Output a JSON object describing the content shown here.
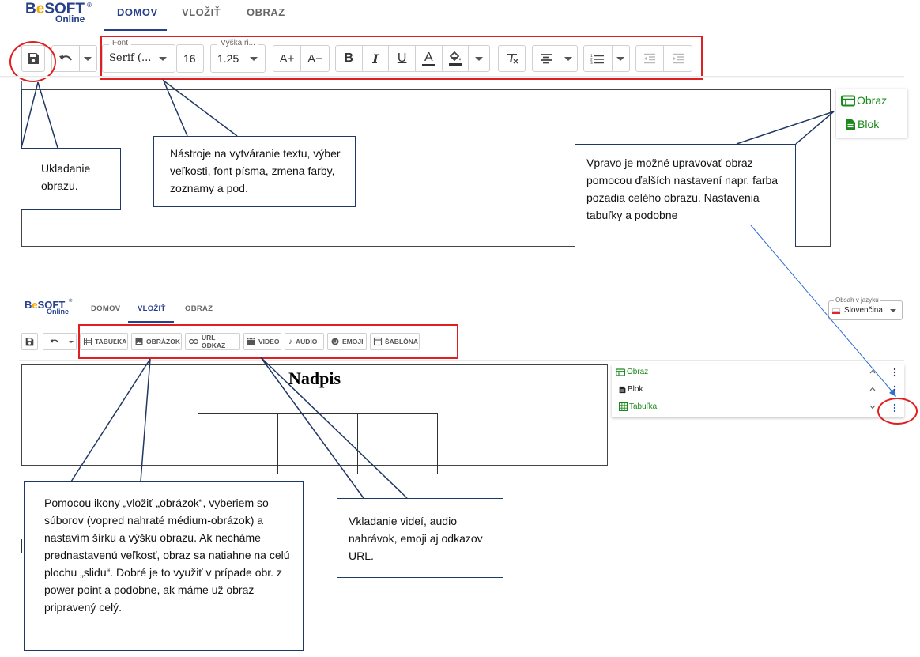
{
  "app": {
    "logo_text_b": "B",
    "logo_text_e": "e",
    "logo_text_soft": "SOFT",
    "logo_reg": "®",
    "logo_sub": "Online"
  },
  "top": {
    "tabs": [
      {
        "label": "DOMOV"
      },
      {
        "label": "VLOŽIŤ"
      },
      {
        "label": "OBRAZ"
      }
    ],
    "toolbar": {
      "font_legend": "Font",
      "font_value": "Serif (...",
      "size_value": "16",
      "line_height_legend": "Výška ri...",
      "line_height_value": "1.25",
      "grow_label": "A+",
      "shrink_label": "A−",
      "bold_label": "B",
      "italic_label": "I",
      "underline_label": "U",
      "color_label": "A"
    },
    "panel": {
      "items": [
        {
          "label": "Obraz",
          "icon": "obraz-icon"
        },
        {
          "label": "Blok",
          "icon": "blok-icon"
        }
      ]
    }
  },
  "bottom": {
    "tabs": [
      {
        "label": "DOMOV"
      },
      {
        "label": "VLOŽIŤ"
      },
      {
        "label": "OBRAZ"
      }
    ],
    "language": {
      "label": "Obsah v jazyku",
      "value": "Slovenčina"
    },
    "toolbar": {
      "buttons": [
        {
          "label": "TABUĽKA",
          "icon": "table-icon"
        },
        {
          "label": "OBRÁZOK",
          "icon": "image-icon"
        },
        {
          "label": "URL ODKAZ",
          "icon": "link-icon"
        },
        {
          "label": "VIDEO",
          "icon": "video-icon"
        },
        {
          "label": "AUDIO",
          "icon": "audio-icon"
        },
        {
          "label": "EMOJI",
          "icon": "emoji-icon"
        },
        {
          "label": "ŠABLÓNA",
          "icon": "template-icon"
        }
      ]
    },
    "canvas_heading": "Nadpis",
    "panel": {
      "items": [
        {
          "label": "Obraz",
          "icon": "obraz-icon",
          "color": "#1a8a1a"
        },
        {
          "label": "Blok",
          "icon": "blok-icon",
          "color": "#222222"
        },
        {
          "label": "Tabuľka",
          "icon": "table-icon",
          "color": "#1a8a1a"
        }
      ]
    }
  },
  "notes": {
    "save": "Ukladanie obrazu.",
    "text_tools": "Nástroje na vytváranie textu, výber veľkosti, font písma, zmena farby, zoznamy a pod.",
    "right_panel": "Vpravo je možné upravovať obraz pomocou ďalších nastavení napr. farba pozadia celého obrazu. Nastavenia tabuľky a podobne",
    "image_insert": "Pomocou ikony „vložiť „obrázok“, vyberiem so súborov (vopred nahraté médium-obrázok) a nastavím šírku a výšku obrazu. Ak necháme prednastavenú veľkosť, obraz sa natiahne na celú plochu „slidu“. Dobré je to využiť v prípade obr. z power point a podobne, ak máme už obraz pripravený celý.",
    "media_insert": "Vkladanie videí, audio nahrávok, emoji aj odkazov URL."
  },
  "colors": {
    "accent": "#27408b",
    "logo_e": "#f2a900",
    "annotation_red": "#e02020",
    "annotation_navy": "#1f3864",
    "panel_green": "#1a8a1a"
  }
}
